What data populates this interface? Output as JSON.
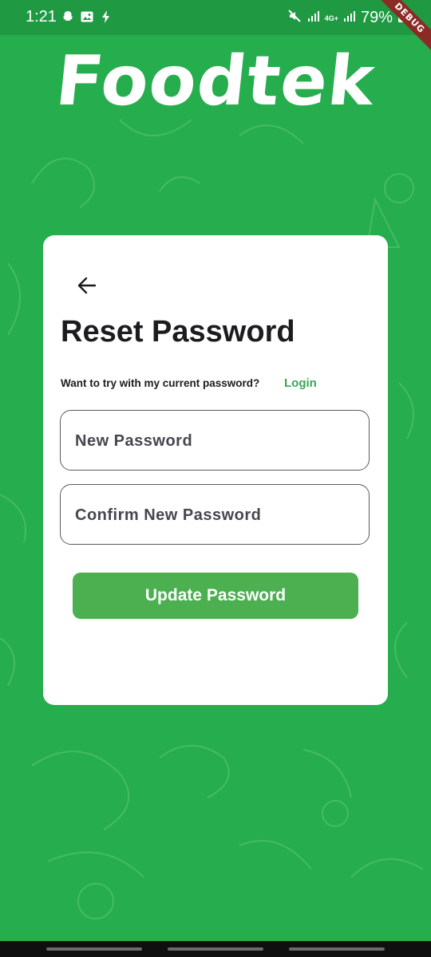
{
  "status_bar": {
    "time": "1:21",
    "network": "4G+",
    "battery": "79%",
    "debug_banner": "DEBUG",
    "icons": [
      "snapchat-icon",
      "gallery-icon",
      "charging-icon",
      "mute-icon",
      "signal-icon",
      "signal-icon",
      "battery-icon"
    ]
  },
  "app": {
    "logo_text": "Foodtek"
  },
  "card": {
    "title": "Reset Password",
    "hint_text": "Want to try with my current password?",
    "login_link": "Login",
    "new_password_placeholder": "New Password",
    "confirm_password_placeholder": "Confirm New Password",
    "update_button": "Update Password"
  },
  "colors": {
    "background": "#26ad4d",
    "accent": "#4caf50",
    "link": "#3aa655",
    "card": "#ffffff"
  }
}
